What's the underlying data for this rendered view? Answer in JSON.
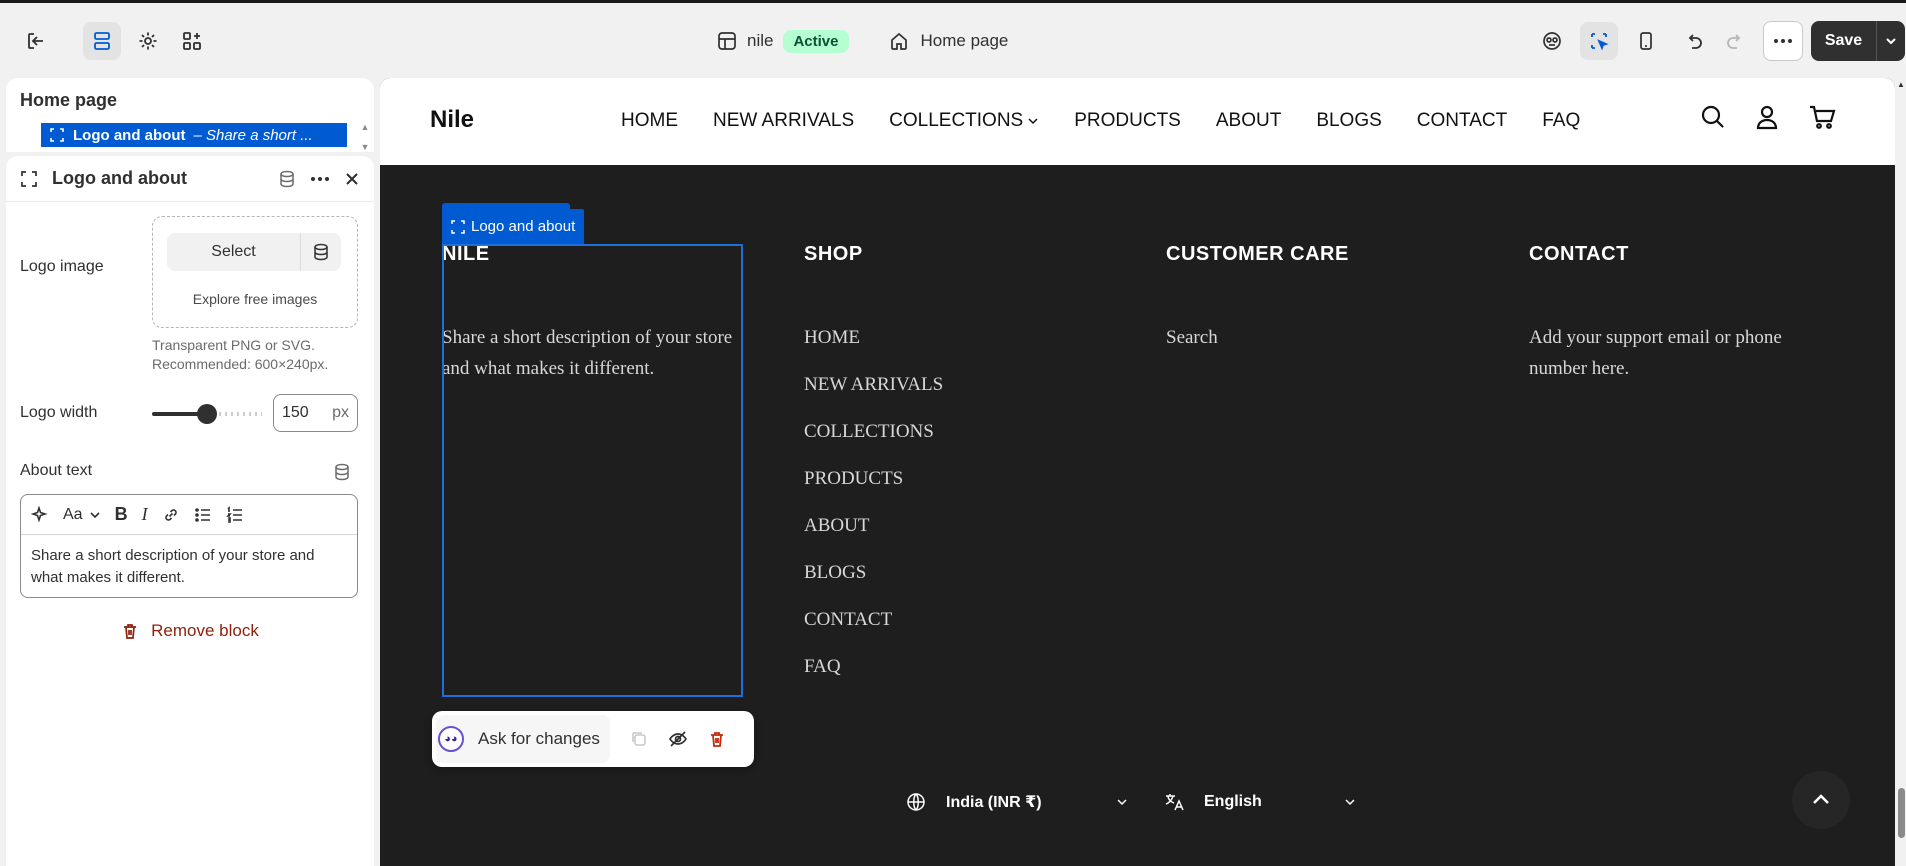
{
  "topbar": {
    "store_name": "nile",
    "status_badge": "Active",
    "page_name": "Home page",
    "save_label": "Save"
  },
  "left_panel": {
    "template_title": "Home page",
    "breadcrumb_block": "Logo and about",
    "breadcrumb_desc": "– Share a short ...",
    "block_title": "Logo and about",
    "logo_image_label": "Logo image",
    "select_label": "Select",
    "explore_label": "Explore free images",
    "hint_line1": "Transparent PNG or SVG.",
    "hint_line2": "Recommended: 600×240px.",
    "logo_width_label": "Logo width",
    "logo_width_value": "150",
    "logo_width_unit": "px",
    "logo_width_fraction": 0.5,
    "about_text_label": "About text",
    "about_text_value": "Share a short description of your store and what makes it different.",
    "remove_block_label": "Remove block"
  },
  "store": {
    "logo": "Nile",
    "nav": [
      "HOME",
      "NEW ARRIVALS",
      "COLLECTIONS",
      "PRODUCTS",
      "ABOUT",
      "BLOGS",
      "CONTACT",
      "FAQ"
    ],
    "selection_tag": "Logo and about",
    "footer": {
      "col1_title": "NILE",
      "col1_text": "Share a short description of your store and what makes it different.",
      "col2_title": "SHOP",
      "col2_links": [
        "HOME",
        "NEW ARRIVALS",
        "COLLECTIONS",
        "PRODUCTS",
        "ABOUT",
        "BLOGS",
        "CONTACT",
        "FAQ"
      ],
      "col3_title": "CUSTOMER CARE",
      "col3_links": [
        "Search"
      ],
      "col4_title": "CONTACT",
      "col4_text": "Add your support email or phone number here."
    },
    "ask_label": "Ask for changes",
    "country": "India (INR ₹)",
    "language": "English"
  },
  "colors": {
    "accent": "#005bd3",
    "active_badge_bg": "#b4fed2",
    "footer_bg": "#1e1e1e",
    "danger": "#8e1f0b"
  }
}
